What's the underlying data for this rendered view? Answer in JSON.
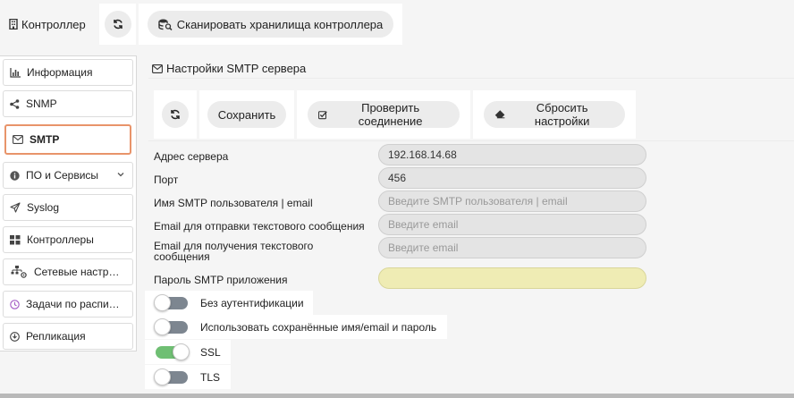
{
  "topbar": {
    "title": "Контроллер",
    "refresh_icon": "refresh-icon",
    "scan_label": "Сканировать хранилища контроллера"
  },
  "sidebar": {
    "items": [
      {
        "label": "Информация",
        "icon": "chart-icon"
      },
      {
        "label": "SNMP",
        "icon": "share-icon"
      },
      {
        "label": "SMTP",
        "icon": "envelope-icon",
        "active": true
      },
      {
        "label": "ПО и Сервисы",
        "icon": "info-icon",
        "has_chevron": true
      },
      {
        "label": "Syslog",
        "icon": "send-icon"
      },
      {
        "label": "Контроллеры",
        "icon": "grid-icon"
      },
      {
        "label": "Сетевые настр…",
        "icon": "network-icon"
      },
      {
        "label": "Задачи по распи…",
        "icon": "clock-icon"
      },
      {
        "label": "Репликация",
        "icon": "replication-icon"
      }
    ]
  },
  "main": {
    "title": "Настройки SMTP сервера",
    "actions": {
      "save_label": "Сохранить",
      "check_label": "Проверить соединение",
      "reset_label": "Сбросить настройки"
    },
    "fields": {
      "server_label": "Адрес сервера",
      "server_value": "192.168.14.68",
      "port_label": "Порт",
      "port_value": "456",
      "user_label": "Имя SMTP пользователя | email",
      "user_placeholder": "Введите SMTP пользователя | email",
      "from_label": "Email для отправки текстового сообщения",
      "from_placeholder": "Введите email",
      "to_label_line1": "Email для получения текстового",
      "to_label_line2": "сообщения",
      "to_placeholder": "Введите email",
      "password_label": "Пароль SMTP приложения"
    },
    "toggles": {
      "no_auth_label": "Без аутентификации",
      "no_auth_on": false,
      "saved_creds_label": "Использовать сохранённые имя/email и пароль",
      "saved_creds_on": false,
      "ssl_label": "SSL",
      "ssl_on": true,
      "tls_label": "TLS",
      "tls_on": false
    }
  },
  "colors": {
    "active_border": "#e8946a",
    "switch_on": "#6fbf73",
    "switch_off": "#7d8690",
    "password_bg": "#efecb4"
  }
}
